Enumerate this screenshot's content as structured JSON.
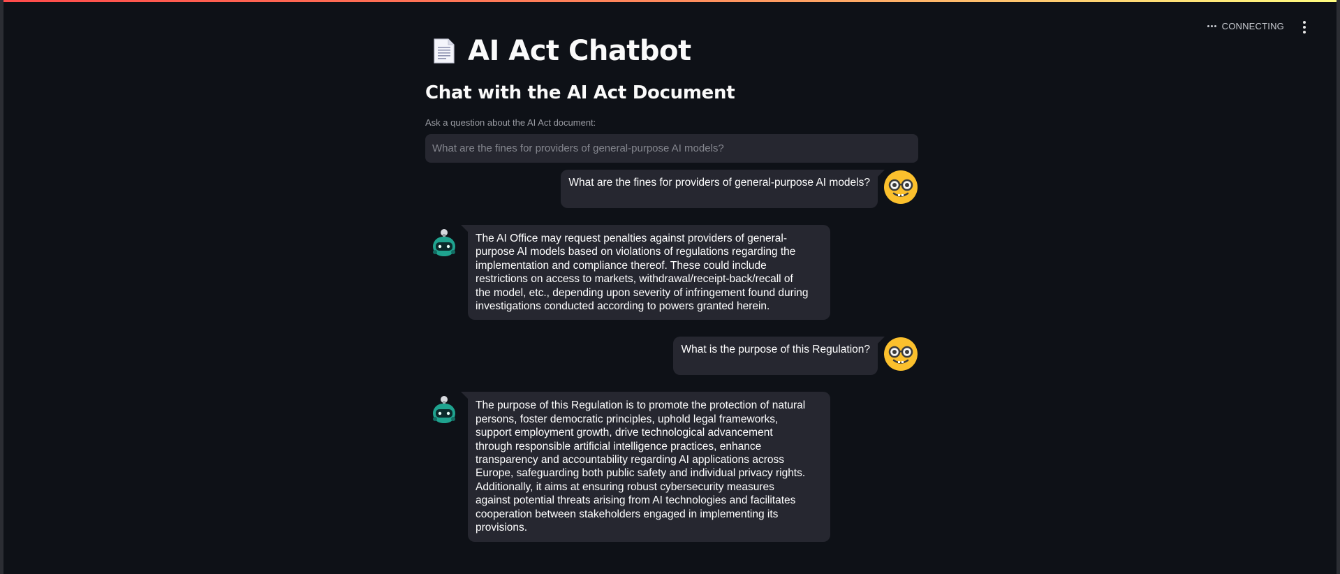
{
  "app": {
    "title": "AI Act Chatbot",
    "title_icon": "document-icon",
    "status": "CONNECTING",
    "status_icon": "ellipsis-icon",
    "menu_icon": "vertical-dots-icon"
  },
  "main": {
    "subtitle": "Chat with the AI Act Document",
    "question_label": "Ask a question about the AI Act document:",
    "question_placeholder": "What are the fines for providers of general-purpose AI models?"
  },
  "messages": [
    {
      "role": "user",
      "avatar": "nerd-face-icon",
      "text": "What are the fines for providers of general-purpose AI models?"
    },
    {
      "role": "bot",
      "avatar": "robot-icon",
      "lines": [
        "The AI Office may request penalties against providers of general-",
        "purpose AI models based on violations of regulations regarding the",
        "implementation and compliance thereof. These could include",
        "restrictions on access to markets, withdrawal/receipt-back/recall of",
        "the model, etc., depending upon severity of infringement found during",
        "investigations conducted according to powers granted herein."
      ]
    },
    {
      "role": "user",
      "avatar": "nerd-face-icon",
      "text": "What is the purpose of this Regulation?"
    },
    {
      "role": "bot",
      "avatar": "robot-icon",
      "lines": [
        "The purpose of this Regulation is to promote the protection of natural",
        "persons, foster democratic principles, uphold legal frameworks,",
        "support employment growth, drive technological advancement",
        "through responsible artificial intelligence practices, enhance",
        "transparency and accountability regarding AI applications across",
        "Europe, safeguarding both public safety and individual privacy rights.",
        "Additionally, it aims at ensuring robust cybersecurity measures",
        "against potential threats arising from AI technologies and facilitates",
        "cooperation between stakeholders engaged in implementing its",
        "provisions."
      ]
    }
  ],
  "colors": {
    "background": "#0e1117",
    "bubble": "#262730",
    "input": "#262730",
    "text": "#fafafa",
    "label": "#9a9ca3",
    "accent_gradient_start": "#ff4b4b",
    "accent_gradient_end": "#fffd80"
  }
}
